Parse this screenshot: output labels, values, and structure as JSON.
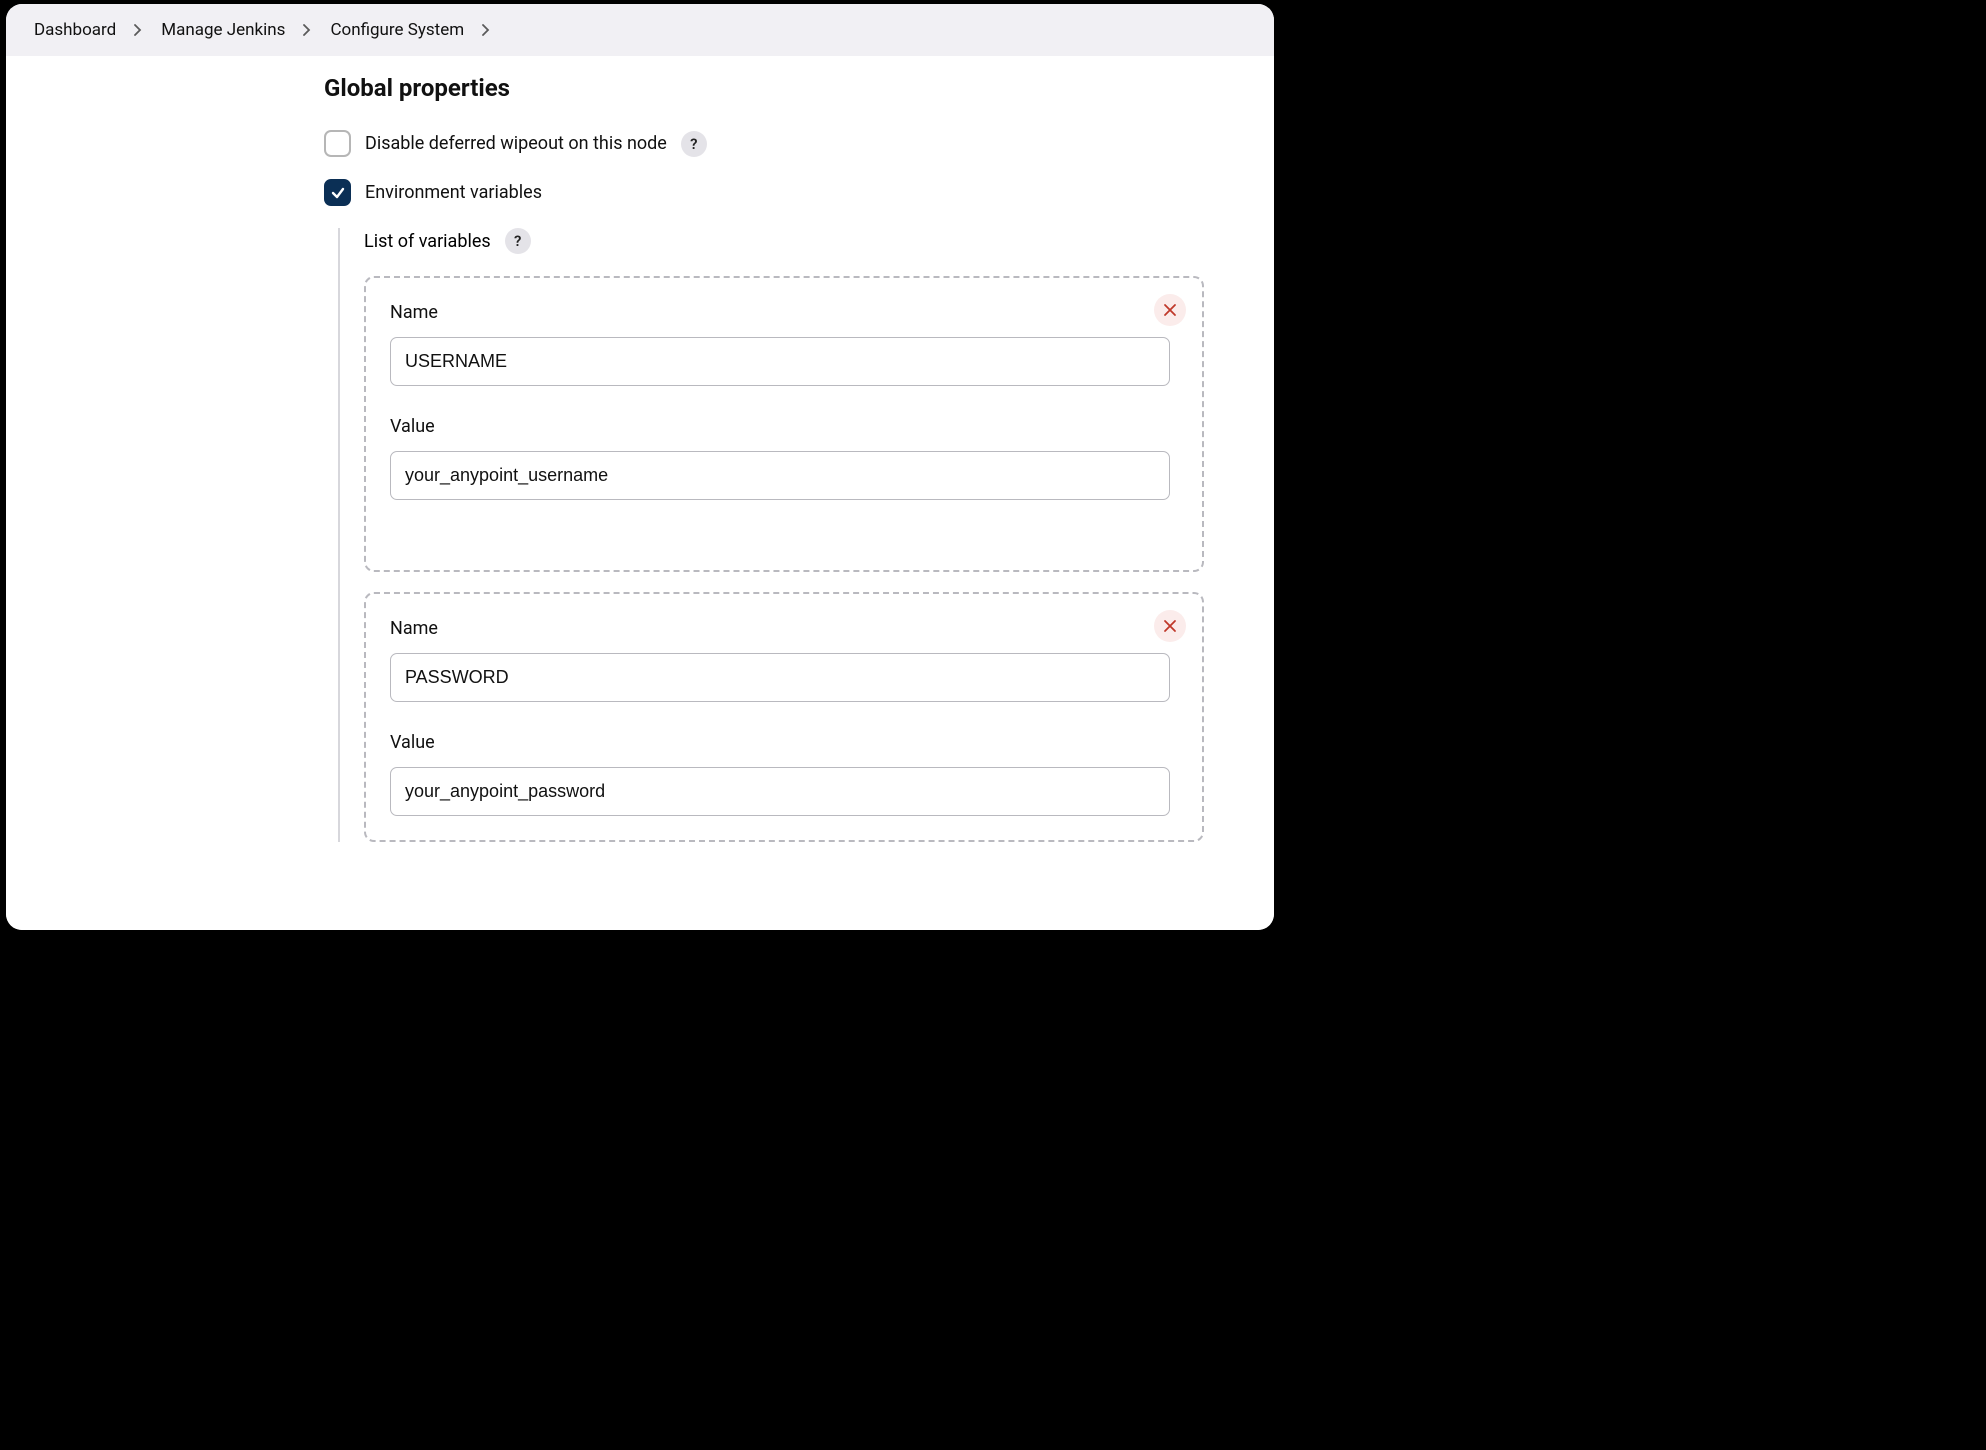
{
  "breadcrumbs": {
    "items": [
      "Dashboard",
      "Manage Jenkins",
      "Configure System"
    ]
  },
  "section": {
    "title": "Global properties"
  },
  "options": {
    "disable_wipeout": {
      "label": "Disable deferred wipeout on this node",
      "checked": false
    },
    "env_vars": {
      "label": "Environment variables",
      "checked": true
    }
  },
  "env_section": {
    "sub_label": "List of variables",
    "field_name_label": "Name",
    "field_value_label": "Value",
    "variables": [
      {
        "name": "USERNAME",
        "value": "your_anypoint_username"
      },
      {
        "name": "PASSWORD",
        "value": "your_anypoint_password"
      }
    ]
  }
}
